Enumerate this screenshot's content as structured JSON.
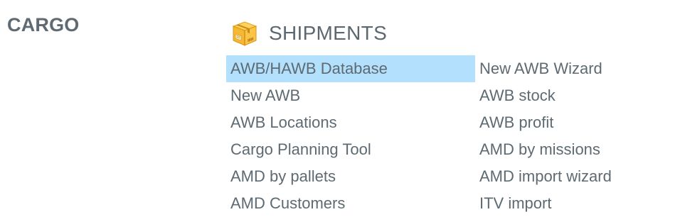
{
  "section": {
    "title": "CARGO"
  },
  "group": {
    "title": "SHIPMENTS",
    "icon": "package-box-icon"
  },
  "colors": {
    "highlight": "#b3e0fd",
    "text": "#5e6a72"
  },
  "menu": {
    "items": [
      {
        "label": "AWB/HAWB Database",
        "active": true
      },
      {
        "label": "New AWB Wizard"
      },
      {
        "label": "New AWB"
      },
      {
        "label": "AWB stock"
      },
      {
        "label": "AWB Locations"
      },
      {
        "label": "AWB profit"
      },
      {
        "label": "Cargo Planning Tool"
      },
      {
        "label": "AMD by missions"
      },
      {
        "label": "AMD by pallets"
      },
      {
        "label": "AMD import wizard"
      },
      {
        "label": "AMD Customers"
      },
      {
        "label": "ITV import"
      }
    ]
  }
}
